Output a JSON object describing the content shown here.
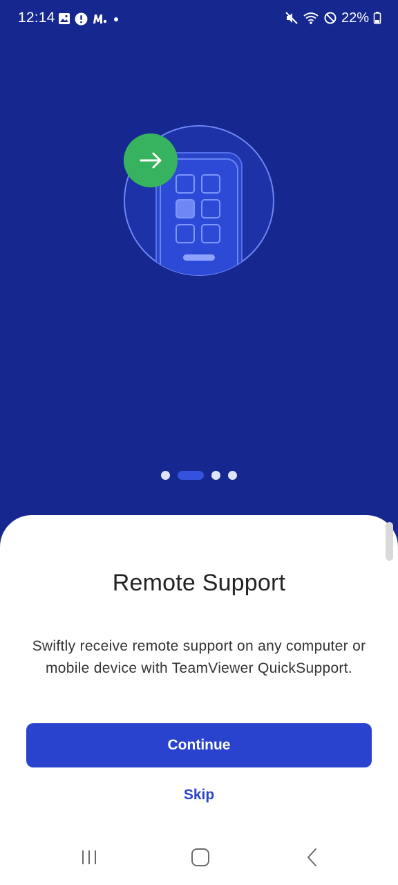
{
  "status_bar": {
    "time": "12:14",
    "battery": "22%",
    "left_icons": [
      "gallery-icon",
      "alert-icon",
      "mobile-data-m-icon",
      "dot-icon"
    ],
    "right_icons": [
      "mute-icon",
      "wifi-icon",
      "do-not-disturb-icon",
      "battery-icon"
    ]
  },
  "onboarding": {
    "page_count": 4,
    "active_page": 2,
    "title": "Remote Support",
    "description": "Swiftly receive remote support on any computer or mobile device with TeamViewer QuickSupport.",
    "continue_label": "Continue",
    "skip_label": "Skip"
  },
  "nav_bar": {
    "buttons": [
      "recents-icon",
      "home-icon",
      "back-icon"
    ]
  },
  "colors": {
    "hero_background": "#16278f",
    "primary_button": "#2943cf",
    "accent_green": "#37b35f",
    "link": "#2a45c6"
  }
}
